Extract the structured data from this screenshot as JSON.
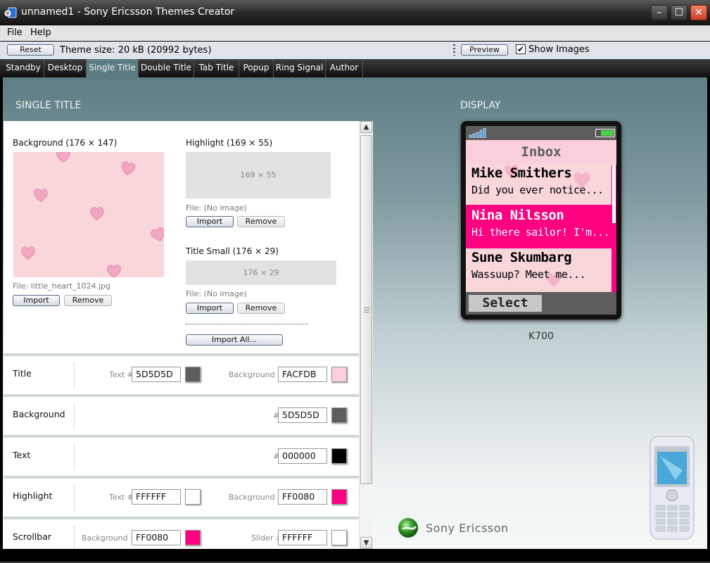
{
  "window": {
    "title": "unnamed1 - Sony Ericsson Themes Creator",
    "controls": {
      "minimize": "–",
      "maximize": "☐",
      "close": "✕"
    }
  },
  "menu": [
    "File",
    "Help"
  ],
  "toolbar": {
    "reset_label": "Reset",
    "theme_size": "Theme size: 20 kB (20992 bytes)",
    "preview_label": "Preview",
    "show_images_label": "Show Images",
    "show_images_checked": true,
    "check_glyph": "✔"
  },
  "tabs": [
    {
      "label": "Standby",
      "active": false
    },
    {
      "label": "Desktop",
      "active": false
    },
    {
      "label": "Single Title",
      "active": true
    },
    {
      "label": "Double Title",
      "active": false
    },
    {
      "label": "Tab Title",
      "active": false
    },
    {
      "label": "Popup",
      "active": false
    },
    {
      "label": "Ring Signal",
      "active": false
    },
    {
      "label": "Author",
      "active": false
    }
  ],
  "left_section": {
    "title": "SINGLE TITLE",
    "images": {
      "background": {
        "label": "Background (176 × 147)",
        "file": "File: little_heart_1024.jpg",
        "import_label": "Import",
        "remove_label": "Remove"
      },
      "highlight": {
        "label": "Highlight (169 × 55)",
        "placeholder": "169 × 55",
        "file": "File: (No image)",
        "import_label": "Import",
        "remove_label": "Remove"
      },
      "title_small": {
        "label": "Title Small (176 × 29)",
        "placeholder": "176 × 29",
        "file": "File: (No image)",
        "import_label": "Import",
        "remove_label": "Remove"
      },
      "import_all_label": "Import All..."
    },
    "color_rows": [
      {
        "label": "Title",
        "fields": [
          {
            "label": "Text #",
            "value": "5D5D5D",
            "color": "#5D5D5D"
          },
          {
            "label": "Background #",
            "value": "FACFDB",
            "color": "#FACFDB"
          }
        ]
      },
      {
        "label": "Background",
        "fields": [
          {
            "label": "#",
            "value": "5D5D5D",
            "color": "#5D5D5D"
          }
        ]
      },
      {
        "label": "Text",
        "fields": [
          {
            "label": "#",
            "value": "000000",
            "color": "#000000"
          }
        ]
      },
      {
        "label": "Highlight",
        "fields": [
          {
            "label": "Text #",
            "value": "FFFFFF",
            "color": "#FFFFFF"
          },
          {
            "label": "Background #",
            "value": "FF0080",
            "color": "#FF0080"
          }
        ]
      },
      {
        "label": "Scrollbar",
        "fields": [
          {
            "label": "Background #",
            "value": "FF0080",
            "color": "#FF0080"
          },
          {
            "label": "Slider #",
            "value": "FFFFFF",
            "color": "#FFFFFF"
          }
        ]
      }
    ]
  },
  "display": {
    "title": "DISPLAY",
    "screen_title": "Inbox",
    "messages": [
      {
        "name": "Mike Smithers",
        "preview": "Did you ever notice...",
        "selected": false
      },
      {
        "name": "Nina Nilsson",
        "preview": "Hi there sailor! I'm...",
        "selected": true
      },
      {
        "name": "Sune Skumbarg",
        "preview": "Wassuup?  Meet me...",
        "selected": false
      }
    ],
    "softkey": "Select",
    "model": "K700",
    "brand": "Sony Ericsson"
  }
}
